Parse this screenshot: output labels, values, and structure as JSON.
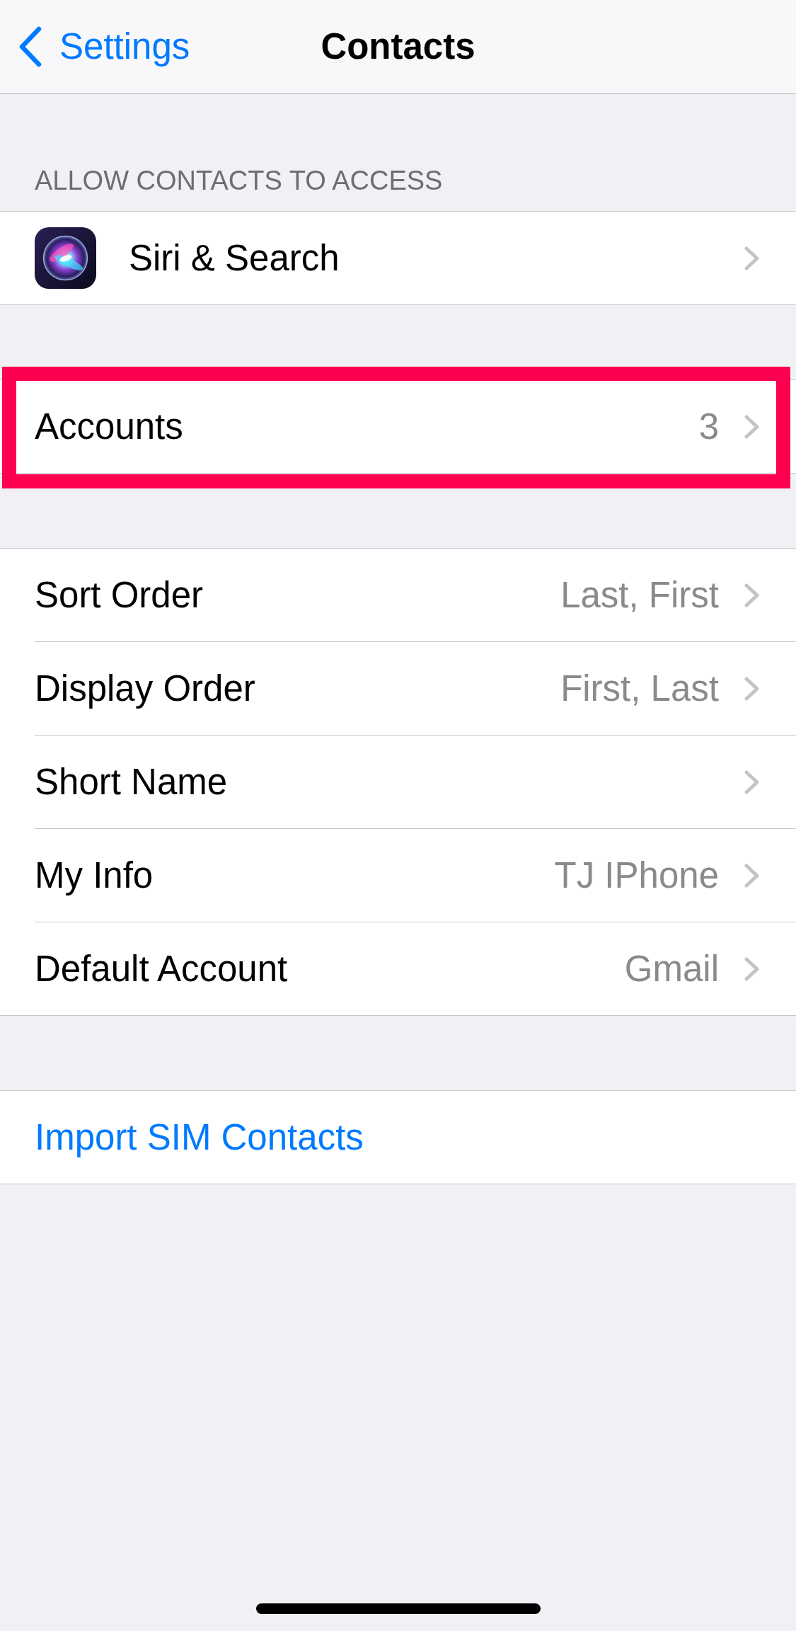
{
  "nav": {
    "back_label": "Settings",
    "title": "Contacts"
  },
  "groups": [
    {
      "header": "ALLOW CONTACTS TO ACCESS",
      "highlighted": false,
      "rows": [
        {
          "kind": "app",
          "label": "Siri & Search"
        }
      ]
    },
    {
      "highlighted": true,
      "rows": [
        {
          "kind": "detail",
          "label": "Accounts",
          "value": "3"
        }
      ]
    },
    {
      "highlighted": false,
      "rows": [
        {
          "kind": "detail",
          "label": "Sort Order",
          "value": "Last, First"
        },
        {
          "kind": "detail",
          "label": "Display Order",
          "value": "First, Last"
        },
        {
          "kind": "detail",
          "label": "Short Name"
        },
        {
          "kind": "detail",
          "label": "My Info",
          "value": "TJ IPhone"
        },
        {
          "kind": "detail",
          "label": "Default Account",
          "value": "Gmail"
        }
      ]
    },
    {
      "highlighted": false,
      "rows": [
        {
          "kind": "action",
          "label": "Import SIM Contacts"
        }
      ]
    }
  ]
}
